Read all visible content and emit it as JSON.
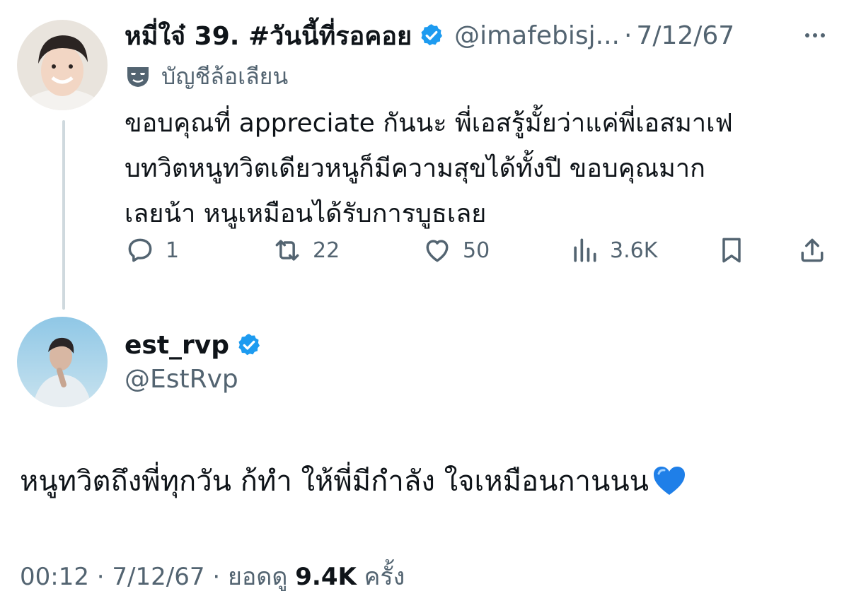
{
  "reply": {
    "display_name": "หมี่ใจ๋ 39. #วันนี้ที่รอคอย",
    "handle": "@imafebisj...",
    "separator": "·",
    "date": "7/12/67",
    "parody_label": "บัญชีล้อเลียน",
    "text_lines": [
      "ขอบคุณที่ appreciate กันนะ พี่เอสรู้มั้ยว่าแค่พี่เอสมาเฟ",
      "บทวิตหนูทวิตเดียวหนูก็มีความสุขได้ทั้งปี ขอบคุณมาก",
      "เลยน้า หนูเหมือนได้รับการบูธเลย"
    ],
    "actions": {
      "replies": "1",
      "reposts": "22",
      "likes": "50",
      "views": "3.6K"
    }
  },
  "main_tweet": {
    "display_name": "est_rvp",
    "handle": "@EstRvp",
    "text": "หนูทวิตถึงพี่ทุกวัน ก้ทำ ให้พี่มีกำลัง ใจเหมือนกานนน",
    "time": "00:12",
    "separator": "·",
    "date": "7/12/67",
    "views_prefix": "ยอดดู",
    "views": "9.4K",
    "views_suffix": "ครั้ง"
  },
  "colors": {
    "text": "#0f1419",
    "secondary": "#536471",
    "verified_blue": "#1d9bf0",
    "thread_line": "#cfd9de",
    "heart_emoji": "#1f7fe8"
  },
  "icons": {
    "verified": "verified-badge-icon",
    "more": "more-dots-icon",
    "parody": "parody-mask-icon",
    "reply": "reply-bubble-icon",
    "repost": "repost-arrows-icon",
    "like": "heart-outline-icon",
    "views": "views-bars-icon",
    "bookmark": "bookmark-icon",
    "share": "share-upload-icon",
    "emoji": "blue-heart-emoji"
  }
}
